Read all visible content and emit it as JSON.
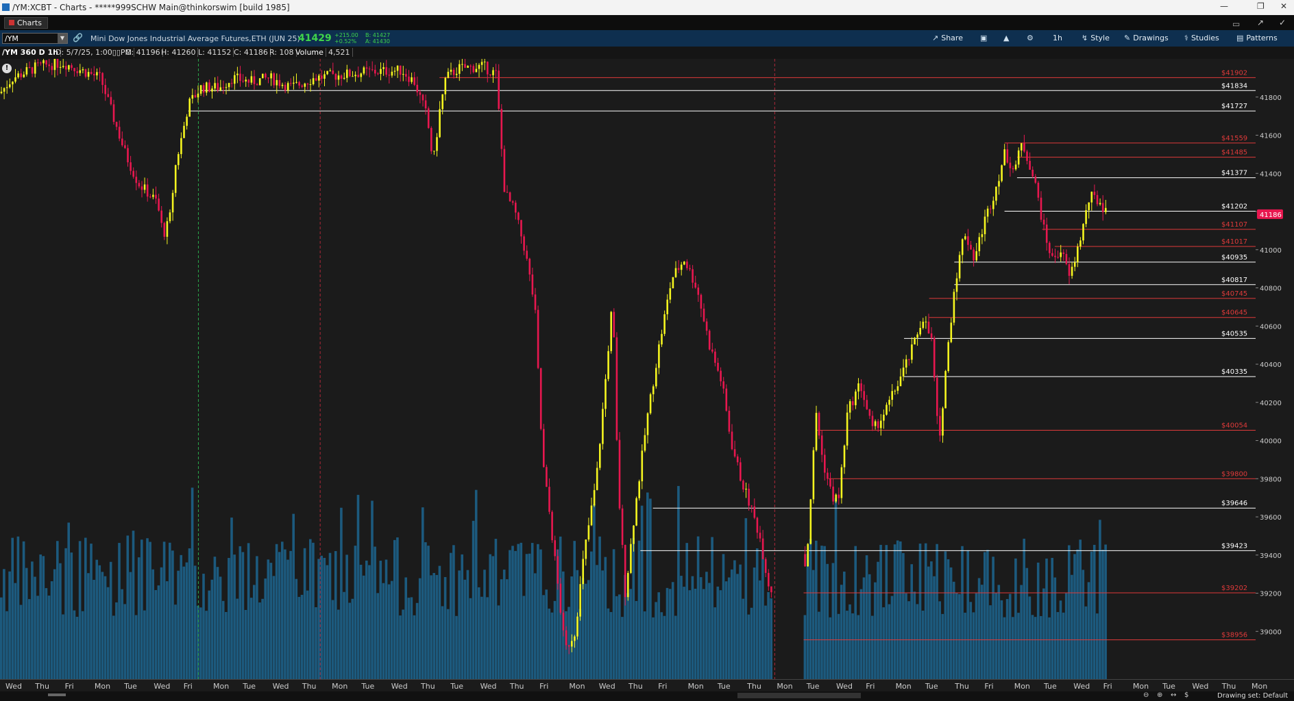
{
  "window": {
    "title": "/YM:XCBT - Charts - *****999SCHW Main@thinkorswim [build 1985]"
  },
  "tabs": {
    "charts_label": "Charts"
  },
  "toolbar": {
    "symbol": "/YM",
    "description": "Mini Dow Jones Industrial Average Futures,ETH (JUN 25)",
    "last": "41429",
    "change": "+215.00",
    "change_pct": "+0.52%",
    "bid": "B: 41427",
    "ask": "A: 41430",
    "share": "Share",
    "timeframe": "1h",
    "style": "Style",
    "drawings": "Drawings",
    "studies": "Studies",
    "patterns": "Patterns"
  },
  "infobar": {
    "aggregation": "/YM 360 D 1h",
    "date": "D: 5/7/25, 1:00▯▯PM",
    "open": "O: 41196",
    "high": "H: 41260",
    "low": "L: 41152",
    "close": "C: 41186",
    "range": "R: 108",
    "volume_label": "Volume",
    "volume_value": "4,521"
  },
  "status": {
    "drawing_set": "Drawing set: Default"
  },
  "colors": {
    "up": "#f5f51f",
    "down": "#e8174f",
    "volume": "#1c5a7e",
    "support": "#ffffff",
    "resistance": "#e03a3a",
    "current_price_bg": "#e8174f"
  },
  "chart_data": {
    "type": "candlestick",
    "interval": "1h",
    "y_axis": {
      "min": 38750,
      "max": 42000,
      "ticks": [
        39000,
        39200,
        39400,
        39600,
        39800,
        40000,
        40200,
        40400,
        40600,
        40800,
        41000,
        41200,
        41400,
        41600,
        41800
      ]
    },
    "current_price": 41186,
    "x_labels": [
      "Wed",
      "Thu",
      "Fri",
      "Mon",
      "Tue",
      "Wed",
      "Fri",
      "Mon",
      "Tue",
      "Wed",
      "Thu",
      "Mon",
      "Tue",
      "Wed",
      "Thu",
      "Tue",
      "Wed",
      "Thu",
      "Fri",
      "Mon",
      "Wed",
      "Thu",
      "Fri",
      "Mon",
      "Tue",
      "Thu",
      "Mon",
      "Tue",
      "Wed",
      "Fri",
      "Mon",
      "Tue",
      "Thu",
      "Fri",
      "Mon",
      "Tue",
      "Wed",
      "Fri",
      "Mon",
      "Tue",
      "Wed",
      "Thu",
      "Mon"
    ],
    "price_levels": [
      {
        "label": "$41902",
        "value": 41902,
        "color": "red",
        "x_start": 0.35
      },
      {
        "label": "$41834",
        "value": 41834,
        "color": "white",
        "x_start": 0.16
      },
      {
        "label": "$41727",
        "value": 41727,
        "color": "white",
        "x_start": 0.15
      },
      {
        "label": "$41559",
        "value": 41559,
        "color": "red",
        "x_start": 0.8
      },
      {
        "label": "$41485",
        "value": 41485,
        "color": "red",
        "x_start": 0.81
      },
      {
        "label": "$41377",
        "value": 41377,
        "color": "white",
        "x_start": 0.81
      },
      {
        "label": "$41202",
        "value": 41202,
        "color": "white",
        "x_start": 0.8
      },
      {
        "label": "$41107",
        "value": 41107,
        "color": "red",
        "x_start": 0.83
      },
      {
        "label": "$41017",
        "value": 41017,
        "color": "red",
        "x_start": 0.84
      },
      {
        "label": "$40935",
        "value": 40935,
        "color": "white",
        "x_start": 0.76
      },
      {
        "label": "$40817",
        "value": 40817,
        "color": "white",
        "x_start": 0.76
      },
      {
        "label": "$40745",
        "value": 40745,
        "color": "red",
        "x_start": 0.74
      },
      {
        "label": "$40645",
        "value": 40645,
        "color": "red",
        "x_start": 0.74
      },
      {
        "label": "$40535",
        "value": 40535,
        "color": "white",
        "x_start": 0.72
      },
      {
        "label": "$40335",
        "value": 40335,
        "color": "white",
        "x_start": 0.72
      },
      {
        "label": "$40054",
        "value": 40054,
        "color": "red",
        "x_start": 0.65
      },
      {
        "label": "$39800",
        "value": 39800,
        "color": "red",
        "x_start": 0.66
      },
      {
        "label": "$39646",
        "value": 39646,
        "color": "white",
        "x_start": 0.52
      },
      {
        "label": "$39423",
        "value": 39423,
        "color": "white",
        "x_start": 0.51
      },
      {
        "label": "$39202",
        "value": 39202,
        "color": "red",
        "x_start": 0.64
      },
      {
        "label": "$38956",
        "value": 38956,
        "color": "red",
        "x_start": 0.64
      }
    ],
    "price_path": [
      [
        0.0,
        41820
      ],
      [
        0.01,
        41900
      ],
      [
        0.03,
        41960
      ],
      [
        0.05,
        41980
      ],
      [
        0.08,
        41900
      ],
      [
        0.09,
        41700
      ],
      [
        0.1,
        41500
      ],
      [
        0.11,
        41350
      ],
      [
        0.125,
        41250
      ],
      [
        0.13,
        41080
      ],
      [
        0.135,
        41150
      ],
      [
        0.14,
        41450
      ],
      [
        0.145,
        41600
      ],
      [
        0.15,
        41760
      ],
      [
        0.16,
        41850
      ],
      [
        0.175,
        41850
      ],
      [
        0.185,
        41900
      ],
      [
        0.2,
        41880
      ],
      [
        0.215,
        41900
      ],
      [
        0.232,
        41850
      ],
      [
        0.25,
        41900
      ],
      [
        0.29,
        41930
      ],
      [
        0.32,
        41940
      ],
      [
        0.33,
        41880
      ],
      [
        0.34,
        41700
      ],
      [
        0.345,
        41450
      ],
      [
        0.35,
        41720
      ],
      [
        0.355,
        41900
      ],
      [
        0.365,
        41950
      ],
      [
        0.385,
        41960
      ],
      [
        0.395,
        41920
      ],
      [
        0.402,
        41300
      ],
      [
        0.41,
        41200
      ],
      [
        0.418,
        41000
      ],
      [
        0.422,
        40850
      ],
      [
        0.426,
        40700
      ],
      [
        0.432,
        39900
      ],
      [
        0.438,
        39600
      ],
      [
        0.445,
        39200
      ],
      [
        0.45,
        38900
      ],
      [
        0.458,
        39000
      ],
      [
        0.465,
        39400
      ],
      [
        0.475,
        39800
      ],
      [
        0.482,
        40300
      ],
      [
        0.488,
        40750
      ],
      [
        0.492,
        39800
      ],
      [
        0.498,
        39200
      ],
      [
        0.505,
        39600
      ],
      [
        0.515,
        40100
      ],
      [
        0.525,
        40500
      ],
      [
        0.535,
        40850
      ],
      [
        0.545,
        40950
      ],
      [
        0.555,
        40800
      ],
      [
        0.565,
        40500
      ],
      [
        0.575,
        40300
      ],
      [
        0.582,
        40000
      ],
      [
        0.59,
        39800
      ],
      [
        0.598,
        39650
      ],
      [
        0.605,
        39500
      ],
      [
        0.612,
        39250
      ],
      [
        0.62,
        39150
      ],
      [
        0.628,
        39380
      ],
      [
        0.635,
        39500
      ],
      [
        0.642,
        39330
      ],
      [
        0.65,
        40150
      ],
      [
        0.655,
        39900
      ],
      [
        0.663,
        39700
      ],
      [
        0.668,
        39700
      ],
      [
        0.675,
        40150
      ],
      [
        0.685,
        40300
      ],
      [
        0.695,
        40050
      ],
      [
        0.705,
        40150
      ],
      [
        0.715,
        40300
      ],
      [
        0.725,
        40450
      ],
      [
        0.735,
        40650
      ],
      [
        0.742,
        40520
      ],
      [
        0.748,
        39950
      ],
      [
        0.752,
        40300
      ],
      [
        0.76,
        40800
      ],
      [
        0.768,
        41100
      ],
      [
        0.776,
        40950
      ],
      [
        0.784,
        41150
      ],
      [
        0.792,
        41300
      ],
      [
        0.8,
        41500
      ],
      [
        0.808,
        41420
      ],
      [
        0.814,
        41560
      ],
      [
        0.82,
        41450
      ],
      [
        0.826,
        41300
      ],
      [
        0.832,
        41080
      ],
      [
        0.838,
        40950
      ],
      [
        0.845,
        41000
      ],
      [
        0.852,
        40850
      ],
      [
        0.86,
        41050
      ],
      [
        0.868,
        41280
      ],
      [
        0.876,
        41250
      ],
      [
        0.882,
        41186
      ]
    ],
    "gaps": [
      [
        0.615,
        0.64
      ]
    ],
    "session_markers": [
      {
        "x": 0.158,
        "color": "green"
      },
      {
        "x": 0.255,
        "color": "red"
      },
      {
        "x": 0.617,
        "color": "red"
      }
    ]
  }
}
